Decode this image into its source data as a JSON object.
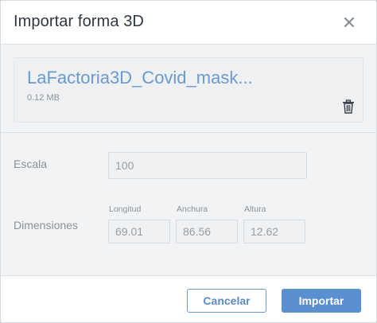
{
  "dialog": {
    "title": "Importar forma 3D",
    "close_icon": "close-icon"
  },
  "file": {
    "name": "LaFactoria3D_Covid_mask...",
    "size": "0.12 MB",
    "delete_icon": "trash-icon"
  },
  "scale": {
    "label": "Escala",
    "value": "100"
  },
  "dimensions": {
    "label": "Dimensiones",
    "length_label": "Longitud",
    "length_value": "69.01",
    "width_label": "Anchura",
    "width_value": "86.56",
    "height_label": "Altura",
    "height_value": "12.62"
  },
  "footer": {
    "cancel_label": "Cancelar",
    "import_label": "Importar"
  },
  "colors": {
    "accent": "#5a8fd0",
    "link": "#6a9ad0"
  }
}
